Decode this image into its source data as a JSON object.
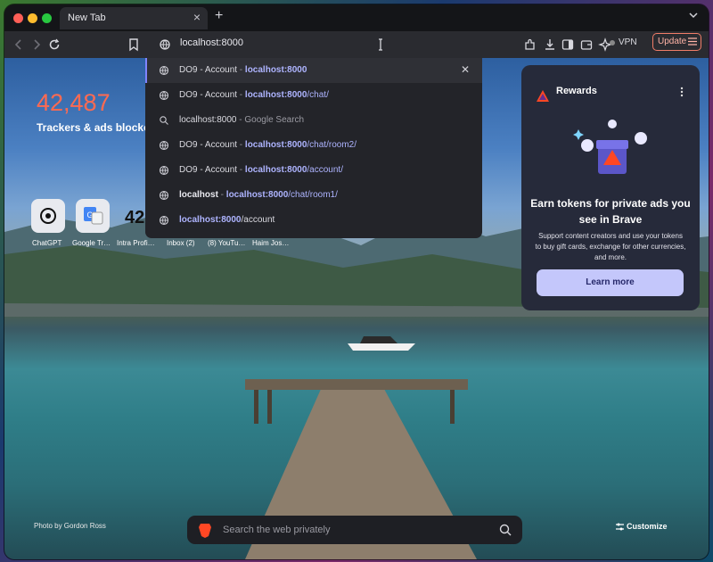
{
  "tab": {
    "title": "New Tab"
  },
  "toolbar": {
    "url": "localhost:8000",
    "vpn_label": "VPN",
    "update_label": "Update"
  },
  "stats": {
    "count": "42,487",
    "label": "Trackers & ads blocked"
  },
  "top_sites": [
    {
      "name": "ChatGPT",
      "icon": "chatgpt-logo"
    },
    {
      "name": "Google Tr…",
      "icon": "google-translate-logo"
    },
    {
      "name": "Intra Profi…",
      "icon": "intra-logo"
    },
    {
      "name": "Inbox (2)"
    },
    {
      "name": "(8) YouTu…"
    },
    {
      "name": "Haim Jos…"
    }
  ],
  "suggestions": [
    {
      "title": "DO9 - Account",
      "sep": " - ",
      "url_bold": "localhost:8000",
      "url_rest": "",
      "icon": "globe-icon",
      "selected": true
    },
    {
      "title": "DO9 - Account",
      "sep": " - ",
      "url_bold": "localhost:8000",
      "url_rest": "/chat/",
      "icon": "globe-icon"
    },
    {
      "title": "localhost:8000",
      "sep": " - ",
      "url_bold": "",
      "url_rest": "Google Search",
      "icon": "search-icon"
    },
    {
      "title": "DO9 - Account",
      "sep": " - ",
      "url_bold": "localhost:8000",
      "url_rest": "/chat/room2/",
      "icon": "globe-icon"
    },
    {
      "title": "DO9 - Account",
      "sep": " - ",
      "url_bold": "localhost:8000",
      "url_rest": "/account/",
      "icon": "globe-icon"
    },
    {
      "title": "localhost",
      "sep": " - ",
      "url_bold": "localhost:8000",
      "url_rest": "/chat/room1/",
      "icon": "globe-icon"
    },
    {
      "title": "",
      "sep": "",
      "url_bold": "localhost:8000",
      "url_rest": "/account",
      "icon": "globe-icon"
    }
  ],
  "rewards": {
    "title": "Rewards",
    "headline": "Earn tokens for private ads you see in Brave",
    "body": "Support content creators and use your tokens to buy gift cards, exchange for other currencies, and more.",
    "button": "Learn more"
  },
  "photo_credit": "Photo by Gordon Ross",
  "customize_label": "Customize",
  "search": {
    "placeholder": "Search the web privately"
  },
  "colors": {
    "accent": "#7f84ff",
    "counter": "#ff6a51",
    "update_border": "#f17d68"
  }
}
